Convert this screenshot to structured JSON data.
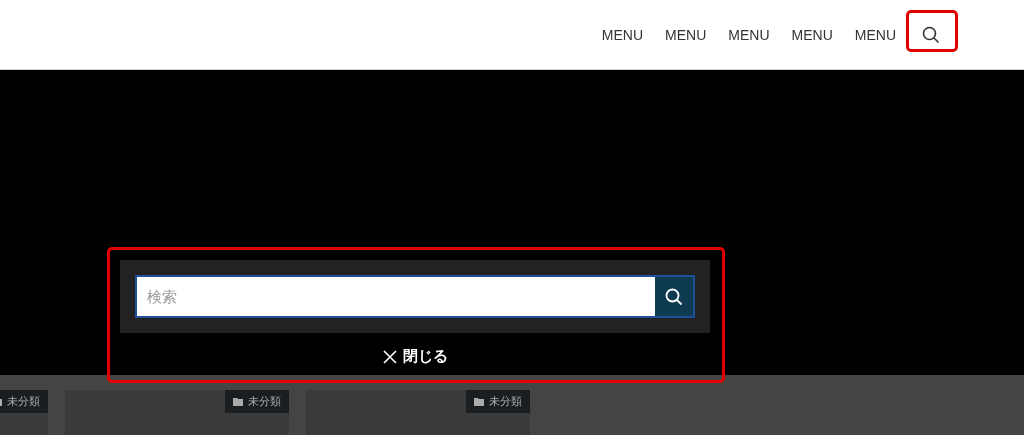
{
  "nav": {
    "items": [
      "MENU",
      "MENU",
      "MENU",
      "MENU",
      "MENU"
    ]
  },
  "search_overlay": {
    "placeholder": "検索",
    "close_label": "閉じる"
  },
  "cards": [
    {
      "category": "未分類"
    },
    {
      "category": "未分類"
    },
    {
      "category": "未分類"
    }
  ]
}
